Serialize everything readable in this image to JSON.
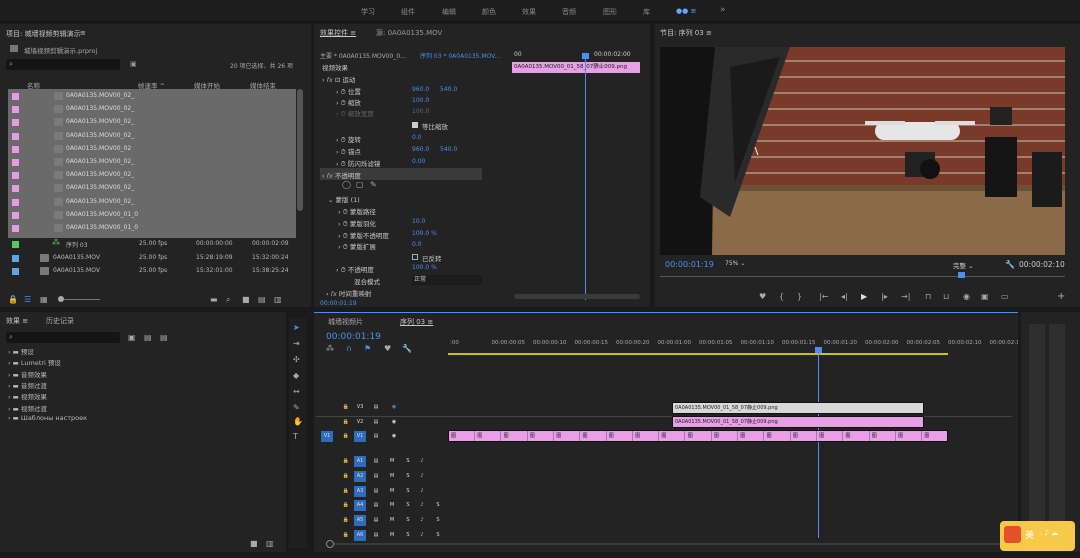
{
  "workspaces": [
    "学习",
    "组件",
    "编辑",
    "颜色",
    "效果",
    "音频",
    "图形",
    "库"
  ],
  "workspace_more": "»",
  "project": {
    "title": "项目: 城墙视频剪辑演示",
    "file": "城墙视频剪辑演示.prproj",
    "count": "20 项已选择，共 26 项",
    "cols": [
      "名称",
      "帧速率 ^",
      "媒体开始",
      "媒体结束"
    ],
    "clips": [
      "0A0A0135.MOV00_02_",
      "0A0A0135.MOV00_02_",
      "0A0A0135.MOV00_02_",
      "0A0A0135.MOV00_02_",
      "0A0A0135.MOV00_02",
      "0A0A0135.MOV00_02_",
      "0A0A0135.MOV00_02_",
      "0A0A0135.MOV00_02_",
      "0A0A0135.MOV00_02_",
      "0A0A0135.MOV00_01_0",
      "0A0A0135.MOV00_01_0"
    ],
    "items": [
      {
        "name": "序列 03",
        "fps": "25.00 fps",
        "start": "00:00:00:00",
        "end": "00:00:02:09"
      },
      {
        "name": "0A0A0135.MOV",
        "fps": "25.00 fps",
        "start": "15:28:19:09",
        "end": "15:32:00:24"
      },
      {
        "name": "0A0A0135.MOV",
        "fps": "25.00 fps",
        "start": "15:32:01:00",
        "end": "15:38:25:24"
      }
    ]
  },
  "effect_controls": {
    "tab": "效果控件 ≡",
    "tab2": "源: 0A0A0135.MOV",
    "master": "主要 * 0A0A0135.MOV00_0...",
    "seq": "序列 03 * 0A0A0135.MOV...",
    "t0": "00",
    "t1": "00:00:02:00",
    "clip_label": "0A0A0135.MOV00_01_58_07静止009.png",
    "video_fx": "视频效果",
    "motion": "运动",
    "props": [
      {
        "name": "位置",
        "v1": "960.0",
        "v2": "540.0"
      },
      {
        "name": "缩放",
        "v1": "100.0",
        "v2": ""
      },
      {
        "name": "缩放宽度",
        "v1": "100.0",
        "v2": ""
      },
      {
        "name": "",
        "v1": "等比缩放",
        "v2": ""
      },
      {
        "name": "旋转",
        "v1": "0.0",
        "v2": ""
      },
      {
        "name": "锚点",
        "v1": "960.0",
        "v2": "540.0"
      },
      {
        "name": "防闪烁滤镜",
        "v1": "0.00",
        "v2": ""
      }
    ],
    "opacity": "不透明度",
    "mask": "蒙版 (1)",
    "mask_props": [
      {
        "name": "蒙版路径",
        "v": ""
      },
      {
        "name": "蒙版羽化",
        "v": "10.0"
      },
      {
        "name": "蒙版不透明度",
        "v": "100.0 %"
      },
      {
        "name": "蒙版扩展",
        "v": "0.0"
      },
      {
        "name": "",
        "v": "已反转"
      }
    ],
    "op_label": "不透明度",
    "op_val": "100.0 %",
    "blend_label": "混合模式",
    "blend_val": "正常",
    "remap": "时间重映射",
    "timecode": "00:00:01:19"
  },
  "program": {
    "title": "节目: 序列 03 ≡",
    "timecode": "00:00:01:19",
    "zoom": "75%",
    "quality": "完整",
    "duration": "00:00:02:10"
  },
  "effects": {
    "tab": "效果 ≡",
    "tab2": "历史记录",
    "folders": [
      "预设",
      "Lumetri 预设",
      "音频效果",
      "音频过渡",
      "视频效果",
      "视频过渡",
      "Шаблоны настроек"
    ]
  },
  "timeline": {
    "tab1": "城墙视频片",
    "tab2": "序列 03 ≡",
    "timecode": "00:00:01:19",
    "ticks": [
      ":00",
      "00:00:00:05",
      "00:00:00:10",
      "00:00:00:15",
      "00:00:00:20",
      "00:00:01:00",
      "00:00:01:05",
      "00:00:01:10",
      "00:00:01:15",
      "00:00:01:20",
      "00:00:02:00",
      "00:00:02:05",
      "00:00:02:10",
      "00:00:02:1"
    ],
    "tracks": [
      "V3",
      "V2",
      "V1",
      "A1",
      "A2",
      "A3",
      "A4",
      "A5",
      "A6"
    ],
    "clip_v3": "0A0A0135.MOV00_01_58_07静止009.png",
    "clip_v2": "0A0A0135.MOV00_01_58_07静止009.png",
    "clip_frame": "图",
    "s_label": "S",
    "m_label": "M",
    "v1_src": "V1"
  },
  "notification": {
    "text": "美"
  },
  "colors": {
    "accent": "#4d8ff0",
    "pink": "#e79fe6",
    "playhead": "#4d8ff0"
  }
}
